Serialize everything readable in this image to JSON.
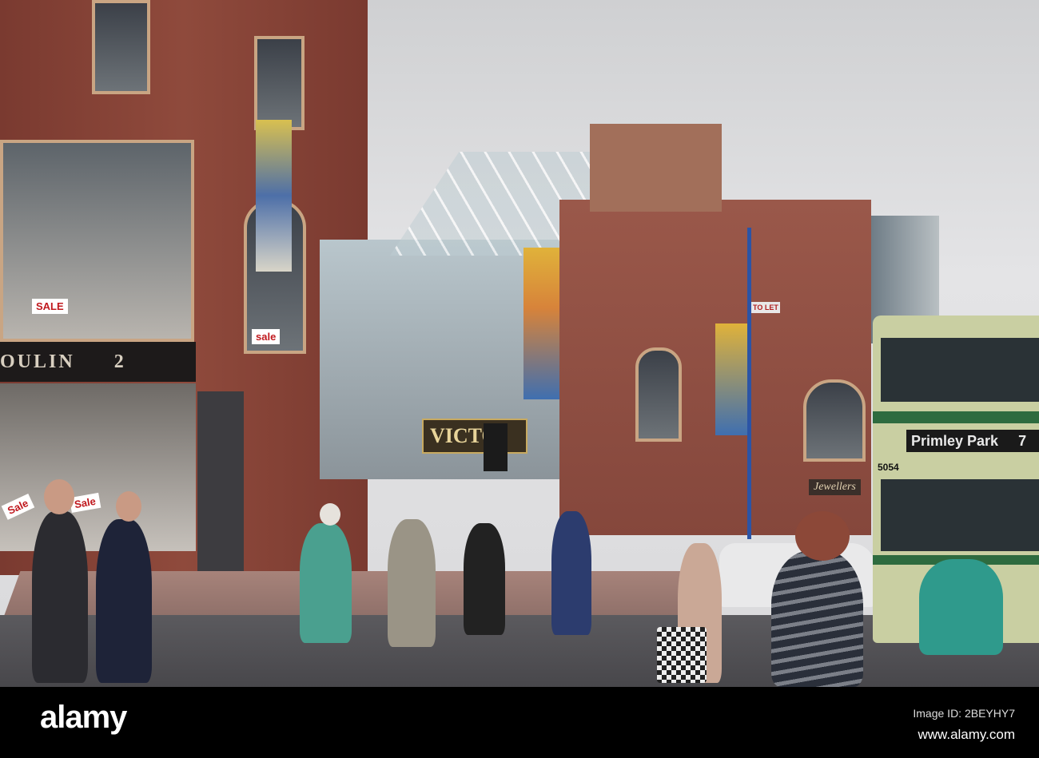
{
  "scene": {
    "arcade_sign": "VICTO",
    "shop_sign": "OULIN",
    "shop_number": "2",
    "sale_tags": [
      "SALE",
      "Sale",
      "Sale",
      "sale"
    ],
    "jewellers_sign": "Jewellers",
    "to_let_sign": "TO LET",
    "bus_destination": "Primley Park",
    "bus_route": "7",
    "bus_fleet_number": "5054"
  },
  "watermark": {
    "logo": "alamy",
    "image_id": "Image ID: 2BEYHY7",
    "website": "www.alamy.com"
  },
  "colors": {
    "brick": "#8f4a3c",
    "bus_cream": "#c9cfa2",
    "bus_green": "#2e6b3f",
    "sky": "#dcdcde"
  }
}
